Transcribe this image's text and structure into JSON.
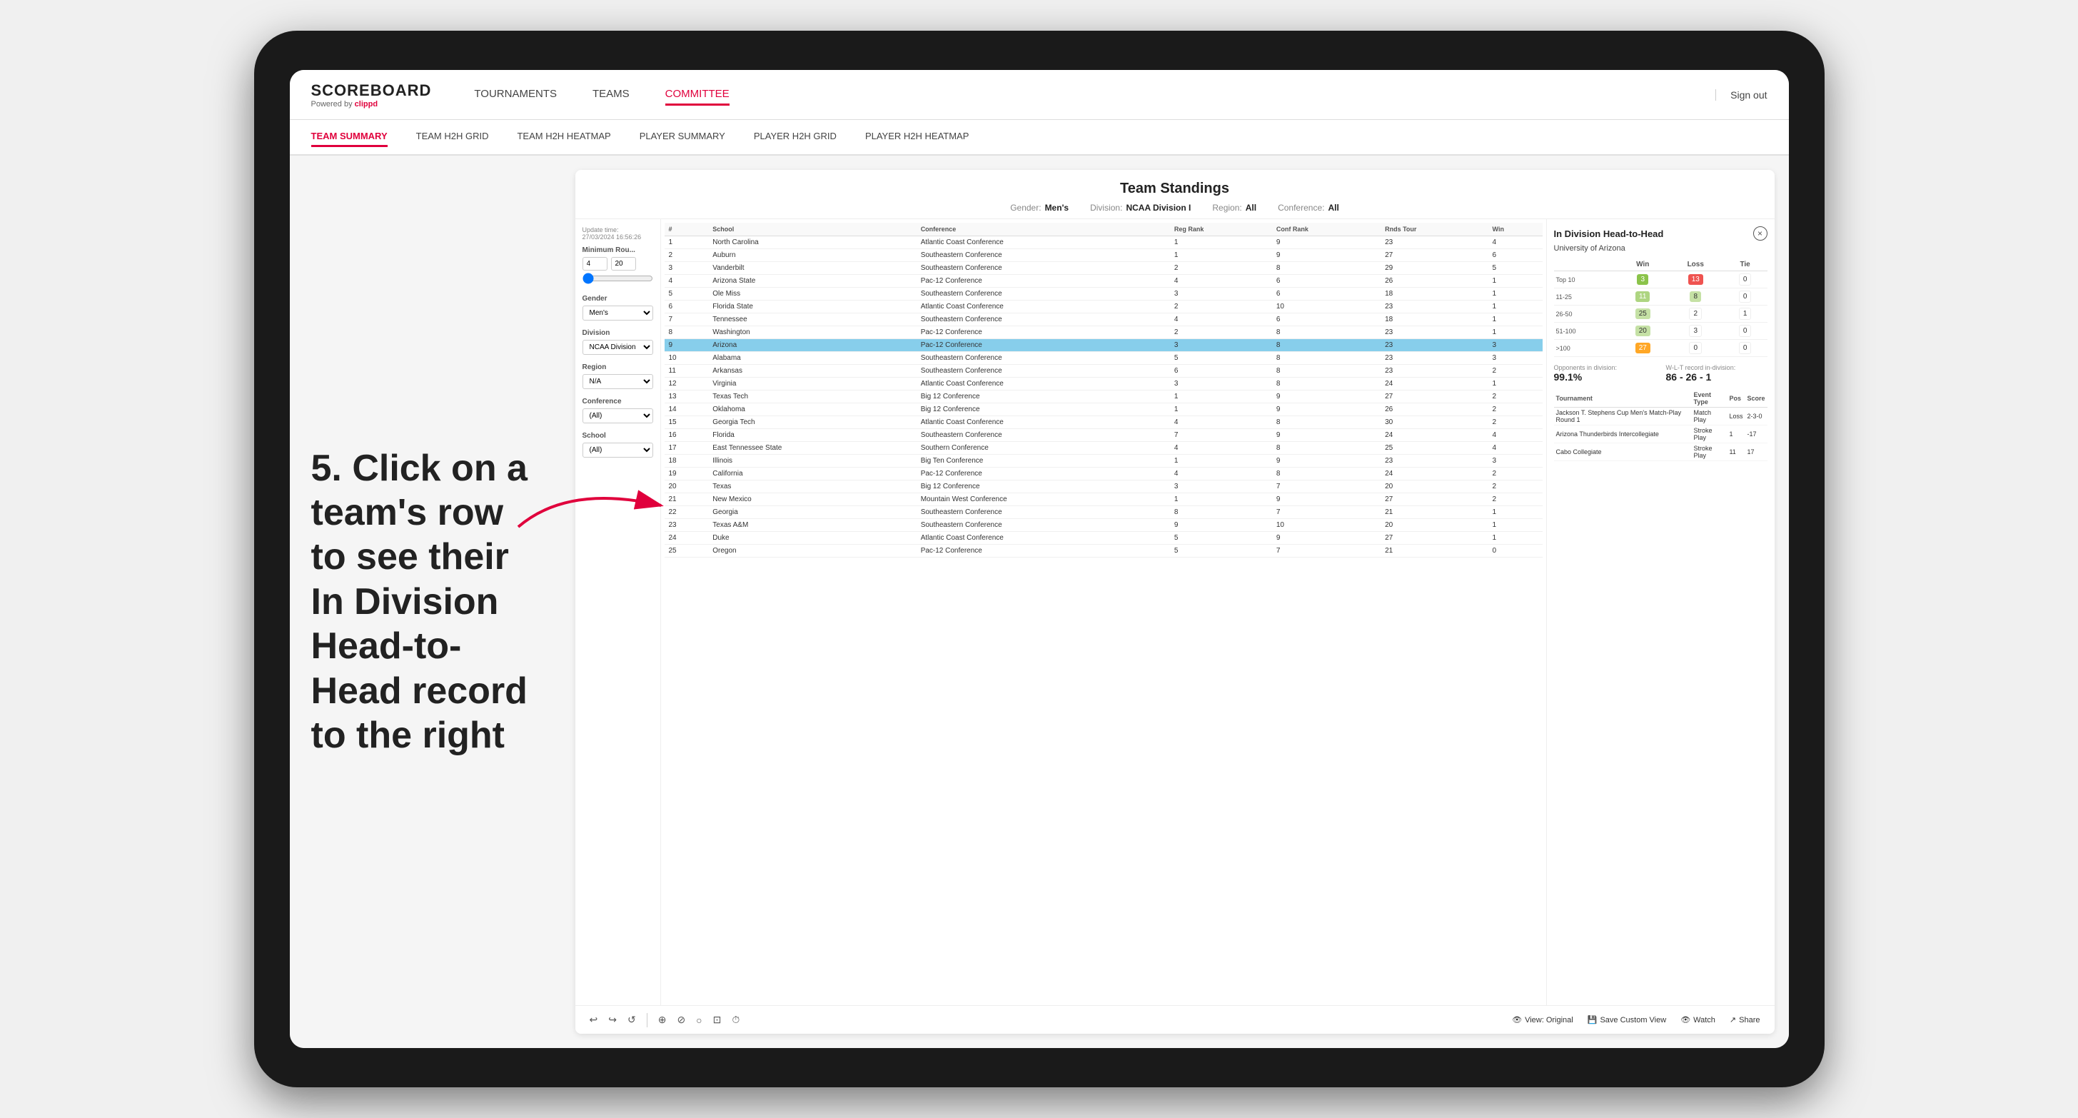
{
  "app": {
    "logo": "SCOREBOARD",
    "logo_sub": "Powered by",
    "logo_brand": "clippd",
    "sign_out": "Sign out"
  },
  "nav": {
    "items": [
      {
        "label": "TOURNAMENTS",
        "active": false
      },
      {
        "label": "TEAMS",
        "active": false
      },
      {
        "label": "COMMITTEE",
        "active": true
      }
    ]
  },
  "sub_nav": {
    "items": [
      {
        "label": "TEAM SUMMARY",
        "active": true
      },
      {
        "label": "TEAM H2H GRID",
        "active": false
      },
      {
        "label": "TEAM H2H HEATMAP",
        "active": false
      },
      {
        "label": "PLAYER SUMMARY",
        "active": false
      },
      {
        "label": "PLAYER H2H GRID",
        "active": false
      },
      {
        "label": "PLAYER H2H HEATMAP",
        "active": false
      }
    ]
  },
  "annotation": {
    "text": "5. Click on a team's row to see their In Division Head-to-Head record to the right"
  },
  "panel": {
    "title": "Team Standings",
    "update_time": "Update time:\n27/03/2024 16:56:26",
    "filters": {
      "gender": {
        "label": "Gender:",
        "value": "Men's"
      },
      "division": {
        "label": "Division:",
        "value": "NCAA Division I"
      },
      "region": {
        "label": "Region:",
        "value": "All"
      },
      "conference": {
        "label": "Conference:",
        "value": "All"
      }
    }
  },
  "left_filters": {
    "min_rounds_label": "Minimum Rou...",
    "min_rounds_value": "4",
    "min_rounds_max": "20",
    "gender_label": "Gender",
    "gender_value": "Men's",
    "division_label": "Division",
    "division_value": "NCAA Division I",
    "region_label": "Region",
    "region_value": "N/A",
    "conference_label": "Conference",
    "conference_value": "(All)",
    "school_label": "School",
    "school_value": "(All)"
  },
  "table": {
    "headers": [
      "#",
      "School",
      "Conference",
      "Reg Rank",
      "Conf Rank",
      "Rds Tour",
      "Win"
    ],
    "rows": [
      {
        "rank": 1,
        "school": "North Carolina",
        "conference": "Atlantic Coast Conference",
        "reg_rank": 1,
        "conf_rank": 9,
        "rds": 23,
        "win": 4
      },
      {
        "rank": 2,
        "school": "Auburn",
        "conference": "Southeastern Conference",
        "reg_rank": 1,
        "conf_rank": 9,
        "rds": 27,
        "win": 6
      },
      {
        "rank": 3,
        "school": "Vanderbilt",
        "conference": "Southeastern Conference",
        "reg_rank": 2,
        "conf_rank": 8,
        "rds": 29,
        "win": 5
      },
      {
        "rank": 4,
        "school": "Arizona State",
        "conference": "Pac-12 Conference",
        "reg_rank": 4,
        "conf_rank": 6,
        "rds": 26,
        "win": 1
      },
      {
        "rank": 5,
        "school": "Ole Miss",
        "conference": "Southeastern Conference",
        "reg_rank": 3,
        "conf_rank": 6,
        "rds": 18,
        "win": 1
      },
      {
        "rank": 6,
        "school": "Florida State",
        "conference": "Atlantic Coast Conference",
        "reg_rank": 2,
        "conf_rank": 10,
        "rds": 23,
        "win": 1
      },
      {
        "rank": 7,
        "school": "Tennessee",
        "conference": "Southeastern Conference",
        "reg_rank": 4,
        "conf_rank": 6,
        "rds": 18,
        "win": 1
      },
      {
        "rank": 8,
        "school": "Washington",
        "conference": "Pac-12 Conference",
        "reg_rank": 2,
        "conf_rank": 8,
        "rds": 23,
        "win": 1
      },
      {
        "rank": 9,
        "school": "Arizona",
        "conference": "Pac-12 Conference",
        "reg_rank": 3,
        "conf_rank": 8,
        "rds": 23,
        "win": 3,
        "highlighted": true
      },
      {
        "rank": 10,
        "school": "Alabama",
        "conference": "Southeastern Conference",
        "reg_rank": 5,
        "conf_rank": 8,
        "rds": 23,
        "win": 3
      },
      {
        "rank": 11,
        "school": "Arkansas",
        "conference": "Southeastern Conference",
        "reg_rank": 6,
        "conf_rank": 8,
        "rds": 23,
        "win": 2
      },
      {
        "rank": 12,
        "school": "Virginia",
        "conference": "Atlantic Coast Conference",
        "reg_rank": 3,
        "conf_rank": 8,
        "rds": 24,
        "win": 1
      },
      {
        "rank": 13,
        "school": "Texas Tech",
        "conference": "Big 12 Conference",
        "reg_rank": 1,
        "conf_rank": 9,
        "rds": 27,
        "win": 2
      },
      {
        "rank": 14,
        "school": "Oklahoma",
        "conference": "Big 12 Conference",
        "reg_rank": 1,
        "conf_rank": 9,
        "rds": 26,
        "win": 2
      },
      {
        "rank": 15,
        "school": "Georgia Tech",
        "conference": "Atlantic Coast Conference",
        "reg_rank": 4,
        "conf_rank": 8,
        "rds": 30,
        "win": 2
      },
      {
        "rank": 16,
        "school": "Florida",
        "conference": "Southeastern Conference",
        "reg_rank": 7,
        "conf_rank": 9,
        "rds": 24,
        "win": 4
      },
      {
        "rank": 17,
        "school": "East Tennessee State",
        "conference": "Southern Conference",
        "reg_rank": 4,
        "conf_rank": 8,
        "rds": 25,
        "win": 4
      },
      {
        "rank": 18,
        "school": "Illinois",
        "conference": "Big Ten Conference",
        "reg_rank": 1,
        "conf_rank": 9,
        "rds": 23,
        "win": 3
      },
      {
        "rank": 19,
        "school": "California",
        "conference": "Pac-12 Conference",
        "reg_rank": 4,
        "conf_rank": 8,
        "rds": 24,
        "win": 2
      },
      {
        "rank": 20,
        "school": "Texas",
        "conference": "Big 12 Conference",
        "reg_rank": 3,
        "conf_rank": 7,
        "rds": 20,
        "win": 2
      },
      {
        "rank": 21,
        "school": "New Mexico",
        "conference": "Mountain West Conference",
        "reg_rank": 1,
        "conf_rank": 9,
        "rds": 27,
        "win": 2
      },
      {
        "rank": 22,
        "school": "Georgia",
        "conference": "Southeastern Conference",
        "reg_rank": 8,
        "conf_rank": 7,
        "rds": 21,
        "win": 1
      },
      {
        "rank": 23,
        "school": "Texas A&M",
        "conference": "Southeastern Conference",
        "reg_rank": 9,
        "conf_rank": 10,
        "rds": 20,
        "win": 1
      },
      {
        "rank": 24,
        "school": "Duke",
        "conference": "Atlantic Coast Conference",
        "reg_rank": 5,
        "conf_rank": 9,
        "rds": 27,
        "win": 1
      },
      {
        "rank": 25,
        "school": "Oregon",
        "conference": "Pac-12 Conference",
        "reg_rank": 5,
        "conf_rank": 7,
        "rds": 21,
        "win": 0
      }
    ]
  },
  "h2h": {
    "title": "In Division Head-to-Head",
    "team": "University of Arizona",
    "table_headers": [
      "",
      "Win",
      "Loss",
      "Tie"
    ],
    "rows": [
      {
        "label": "Top 10",
        "win": 3,
        "loss": 13,
        "tie": 0,
        "win_color": "green",
        "loss_color": "red"
      },
      {
        "label": "11-25",
        "win": 11,
        "loss": 8,
        "tie": 0,
        "win_color": "light-green",
        "loss_color": "light-red"
      },
      {
        "label": "26-50",
        "win": 25,
        "loss": 2,
        "tie": 1,
        "win_color": "light-green",
        "loss_color": "zero"
      },
      {
        "label": "51-100",
        "win": 20,
        "loss": 3,
        "tie": 0,
        "win_color": "yellow-green",
        "loss_color": "zero"
      },
      {
        "label": ">100",
        "win": 27,
        "loss": 0,
        "tie": 0,
        "win_color": "orange",
        "loss_color": "zero"
      }
    ],
    "opponents_label": "Opponents in division:",
    "opponents_value": "99.1%",
    "record_label": "W-L-T record in-division:",
    "record_value": "86 - 26 - 1",
    "tournament_headers": [
      "Tournament",
      "Event Type",
      "Pos",
      "Score"
    ],
    "tournaments": [
      {
        "name": "Jackson T. Stephens Cup Men's Match-Play Round 1",
        "type": "Match Play",
        "pos": "Loss",
        "score": "2-3-0"
      },
      {
        "name": "Arizona Thunderbirds Intercollegiate",
        "type": "Stroke Play",
        "pos": "1",
        "score": "-17"
      },
      {
        "name": "Cabo Collegiate",
        "type": "Stroke Play",
        "pos": "11",
        "score": "17"
      }
    ]
  },
  "toolbar": {
    "icons": [
      "↩",
      "↪",
      "↺",
      "⊕",
      "⊘",
      "○",
      "⊡",
      "⊞"
    ],
    "view_original": "View: Original",
    "save_custom": "Save Custom View",
    "watch": "Watch",
    "share": "Share"
  }
}
